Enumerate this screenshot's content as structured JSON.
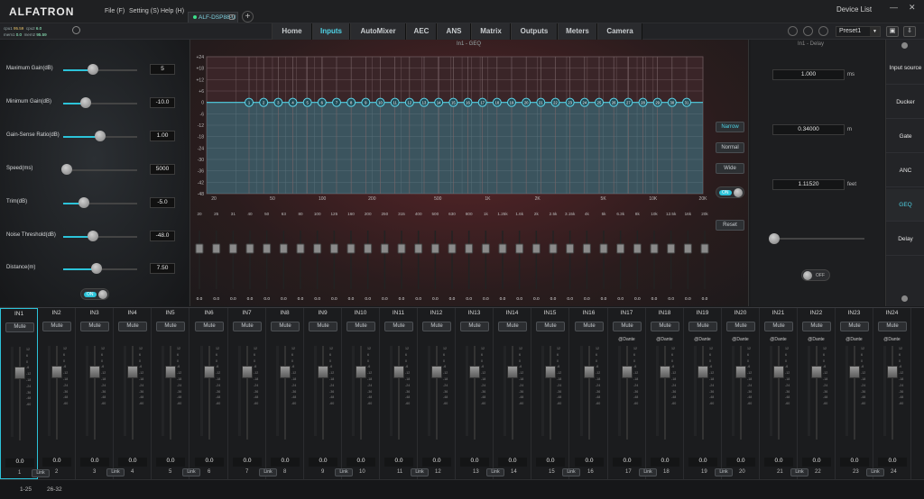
{
  "app": {
    "logo": "ALFATRON",
    "menus": [
      "File (F)",
      "Setting (S)",
      "Help (H)"
    ],
    "device_tab": "ALF-DSP88-U",
    "device_list": "Device List"
  },
  "stats": {
    "cpu1_label": "cpu1",
    "cpu1": "95.59",
    "cpu2_label": "cpu2",
    "cpu2": "6.0",
    "mem1_label": "mem1",
    "mem1": "0.0",
    "mem2_label": "mem2",
    "mem2": "95.59"
  },
  "nav": {
    "tabs": [
      "Home",
      "Inputs",
      "AutoMixer",
      "AEC",
      "ANS",
      "Matrix",
      "Outputs",
      "Meters",
      "Camera"
    ],
    "active": "Inputs",
    "preset": "Preset1"
  },
  "left": {
    "params": [
      {
        "label": "Maximum Gain(dB)",
        "value": "5",
        "level": 0.4
      },
      {
        "label": "Minimum Gain(dB)",
        "value": "-10.0",
        "level": 0.3
      },
      {
        "label": "Gain-Sense Ratio(dB)",
        "value": "1.00",
        "level": 0.5
      },
      {
        "label": "Speed(ms)",
        "value": "5000",
        "level": 0.05
      },
      {
        "label": "Trim(dB)",
        "value": "-5.0",
        "level": 0.28
      },
      {
        "label": "Noise Threshold(dB)",
        "value": "-48.0",
        "level": 0.4
      },
      {
        "label": "Distance(m)",
        "value": "7.50",
        "level": 0.45
      }
    ],
    "toggle": "ON"
  },
  "geq": {
    "title": "In1 - GEQ",
    "ylabels": [
      "+24",
      "+18",
      "+12",
      "+6",
      "0",
      "-6",
      "-12",
      "-18",
      "-24",
      "-30",
      "-36",
      "-42",
      "-48"
    ],
    "xlabels": [
      "20",
      "50",
      "100",
      "200",
      "500",
      "1K",
      "2K",
      "5K",
      "10K",
      "20K"
    ],
    "band_labels": [
      "20",
      "25",
      "31",
      "40",
      "50",
      "63",
      "80",
      "100",
      "125",
      "160",
      "200",
      "250",
      "315",
      "400",
      "500",
      "630",
      "800",
      "1k",
      "1.25k",
      "1.6k",
      "2k",
      "2.5k",
      "3.15k",
      "4k",
      "5k",
      "6.3k",
      "8k",
      "10k",
      "12.5k",
      "16k",
      "20k"
    ],
    "points": [
      "1",
      "2",
      "3",
      "4",
      "5",
      "6",
      "7",
      "8",
      "9",
      "10",
      "11",
      "12",
      "13",
      "14",
      "15",
      "16",
      "17",
      "18",
      "19",
      "20",
      "21",
      "22",
      "23",
      "24",
      "25",
      "26",
      "27",
      "28",
      "29",
      "30",
      "31"
    ],
    "band_value": "0.0",
    "buttons": [
      "Narrow",
      "Normal",
      "Wide",
      "Reset"
    ],
    "active_button": "Narrow",
    "toggle": "ON"
  },
  "delay": {
    "title": "In1 - Delay",
    "values": [
      {
        "value": "1.000",
        "unit": "ms"
      },
      {
        "value": "0.34000",
        "unit": "m"
      },
      {
        "value": "1.11520",
        "unit": "feet"
      }
    ],
    "toggle": "OFF"
  },
  "sidebar": {
    "items": [
      "Input source",
      "Ducker",
      "Gate",
      "ANC",
      "GEQ",
      "Delay"
    ],
    "active": "GEQ"
  },
  "mixer": {
    "mute_label": "Mute",
    "link_label": "Link",
    "dante_label": "@Dante",
    "channels": [
      "IN1",
      "IN2",
      "IN3",
      "IN4",
      "IN5",
      "IN6",
      "IN7",
      "IN8",
      "IN9",
      "IN10",
      "IN11",
      "IN12",
      "IN13",
      "IN14",
      "IN15",
      "IN16",
      "IN17",
      "IN18",
      "IN19",
      "IN20",
      "IN21",
      "IN22",
      "IN23",
      "IN24"
    ],
    "values": [
      "0.0",
      "0.0",
      "0.0",
      "0.0",
      "0.0",
      "0.0",
      "0.0",
      "0.0",
      "0.0",
      "0.0",
      "0.0",
      "0.0",
      "0.0",
      "0.0",
      "0.0",
      "0.0",
      "0.0",
      "0.0",
      "0.0",
      "0.0",
      "0.0",
      "0.0",
      "0.0",
      "0.0"
    ],
    "numbers": [
      "1",
      "2",
      "3",
      "4",
      "5",
      "6",
      "7",
      "8",
      "9",
      "10",
      "11",
      "12",
      "13",
      "14",
      "15",
      "16",
      "17",
      "18",
      "19",
      "20",
      "21",
      "22",
      "23",
      "24"
    ],
    "scale": [
      "12",
      "6",
      "0",
      "-6",
      "-12",
      "-18",
      "-24",
      "-36",
      "-48",
      "-60"
    ]
  },
  "bottom": {
    "tabs": [
      "1-25",
      "26-32"
    ]
  },
  "colors": {
    "accent": "#2cc3d9",
    "geq_bg": "#3b2426"
  }
}
